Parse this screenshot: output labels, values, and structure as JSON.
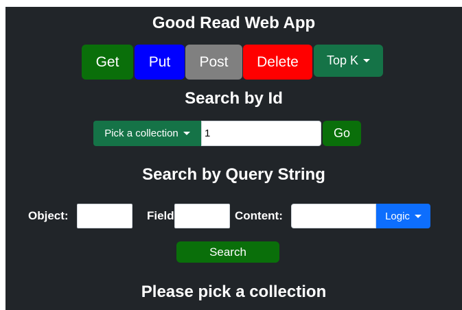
{
  "header": {
    "title": "Good Read Web App"
  },
  "toolbar": {
    "get_label": "Get",
    "put_label": "Put",
    "post_label": "Post",
    "delete_label": "Delete",
    "topk_label": "Top K"
  },
  "search_by_id": {
    "heading": "Search by Id",
    "collection_label": "Pick a collection",
    "id_value": "1",
    "go_label": "Go"
  },
  "query_search": {
    "heading": "Search by Query String",
    "object_label": "Object:",
    "object_value": "",
    "field_label": "Field:",
    "field_value": "",
    "content_label": "Content:",
    "content_value": "",
    "logic_label": "Logic",
    "search_label": "Search"
  },
  "status": {
    "message": "Please pick a collection"
  },
  "colors": {
    "background": "#212529",
    "success": "#0a6f0a",
    "primary": "#0000ff",
    "secondary": "#808080",
    "danger": "#ff0000",
    "dropdown_green": "#157347",
    "logic_blue": "#0d6efd"
  }
}
